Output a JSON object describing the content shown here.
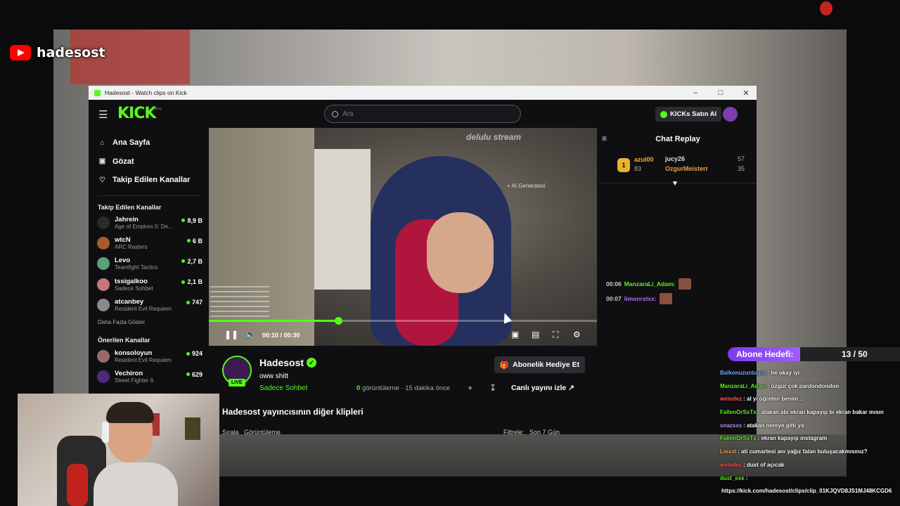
{
  "brand": {
    "name": "hadesost"
  },
  "window": {
    "title": "Hadesost - Watch clips on Kick"
  },
  "topnav": {
    "logo": "KICK",
    "beta": "BETA",
    "search_placeholder": "Ara",
    "kicks_button": "KICKs Satın Al"
  },
  "sidebar": {
    "nav": [
      {
        "label": "Ana Sayfa",
        "icon": "home-icon"
      },
      {
        "label": "Gözat",
        "icon": "browse-icon"
      },
      {
        "label": "Takip Edilen Kanallar",
        "icon": "heart-icon"
      }
    ],
    "followed_heading": "Takip Edilen Kanallar",
    "followed": [
      {
        "name": "Jahrein",
        "game": "Age of Empires II: De...",
        "viewers": "8,9 B",
        "color": "#2b2b2b"
      },
      {
        "name": "wtcN",
        "game": "ARC Raiders",
        "viewers": "6 B",
        "color": "#a85a2a"
      },
      {
        "name": "Levo",
        "game": "Teamfight Tactics",
        "viewers": "2,7 B",
        "color": "#5aa07a"
      },
      {
        "name": "tssigalkoo",
        "game": "Sadece Sohbet",
        "viewers": "2,1 B",
        "color": "#c9747a"
      },
      {
        "name": "atcanbey",
        "game": "Resident Evil Requiem",
        "viewers": "747",
        "color": "#8a8a8a"
      }
    ],
    "show_more": "Daha Fazla Göster",
    "recommended_heading": "Önerilen Kanallar",
    "recommended": [
      {
        "name": "konsoloyun",
        "game": "Resident Evil Requiem",
        "viewers": "924",
        "color": "#9a6a6a"
      },
      {
        "name": "Vechiron",
        "game": "Street Fighter 6",
        "viewers": "629",
        "color": "#4b2a7a"
      }
    ]
  },
  "video": {
    "watermark": "delulu stream",
    "ai_badge": "+ AI Generated",
    "current_time": "00:10",
    "duration": "00:30",
    "progress": 0.333
  },
  "channel": {
    "name": "Hadesost",
    "live": "LIVE",
    "clip_title": "oww shitt",
    "category": "Sadece Sohbet",
    "views_count": "0",
    "views_label": "görüntüleme",
    "time_ago": "15 dakika önce",
    "gift_button": "Abonelik Hediye Et",
    "watch_live": "Canlı yayını izle",
    "more_clips": "Hadesost yayıncısının diğer klipleri",
    "sort_label": "Sırala",
    "sort_value": "Görüntüleme",
    "filter_label": "Filtrele:",
    "filter_value": "Son 7 Gün"
  },
  "chat": {
    "title": "Chat Replay",
    "leaderboard": {
      "rank": "1",
      "first": {
        "name": "azul00",
        "value": "83"
      },
      "second": {
        "name": "jucy26",
        "value": "57"
      },
      "third": {
        "name": "OzgurMeisterr",
        "value": "35"
      }
    },
    "messages": [
      {
        "time": "00:06",
        "user": "ManzaraLi_Adam:",
        "color": "#53fc18"
      },
      {
        "time": "00:07",
        "user": "limonrstxx:",
        "color": "#b56bff"
      }
    ]
  },
  "sub_goal": {
    "label": "Abone Hedefi:",
    "count": "13 / 50",
    "current": 13,
    "target": 50
  },
  "stream_chat": [
    {
      "user": "Balkonuzuntugra",
      "text": ": he okay iyi",
      "color": "#7aa6ff"
    },
    {
      "user": "ManzaraLi_Adam",
      "text": ": özgür çok pardondondon",
      "color": "#53fc18"
    },
    {
      "user": "weindez",
      "text": ": al yı öğreten benim ..",
      "color": "#ff5a5a"
    },
    {
      "user": "FallenOrSsTx",
      "text": ": atakan abı ekran kapayıp bı ekran bakar mısın",
      "color": "#53fc18"
    },
    {
      "user": "snazsxs",
      "text": ": atakan nereye gitti ya",
      "color": "#c08cff"
    },
    {
      "user": "FallenOrSsTx",
      "text": ": ekran kapayıp ınstagram",
      "color": "#53fc18"
    },
    {
      "user": "Lioxxl",
      "text": ": ati cumartesi anı yağız falan buluşacakmısınız?",
      "color": "#ffb347"
    },
    {
      "user": "weindez",
      "text": ": dust of açıcak",
      "color": "#ff5a5a"
    },
    {
      "user": "dust_exe",
      "text": ":",
      "color": "#53fc18"
    },
    {
      "user": "",
      "text": "https://kick.com/hadesost/clips/clip_01KJQVD8JS1MJ48KCGD6",
      "color": "#ffffff"
    }
  ]
}
